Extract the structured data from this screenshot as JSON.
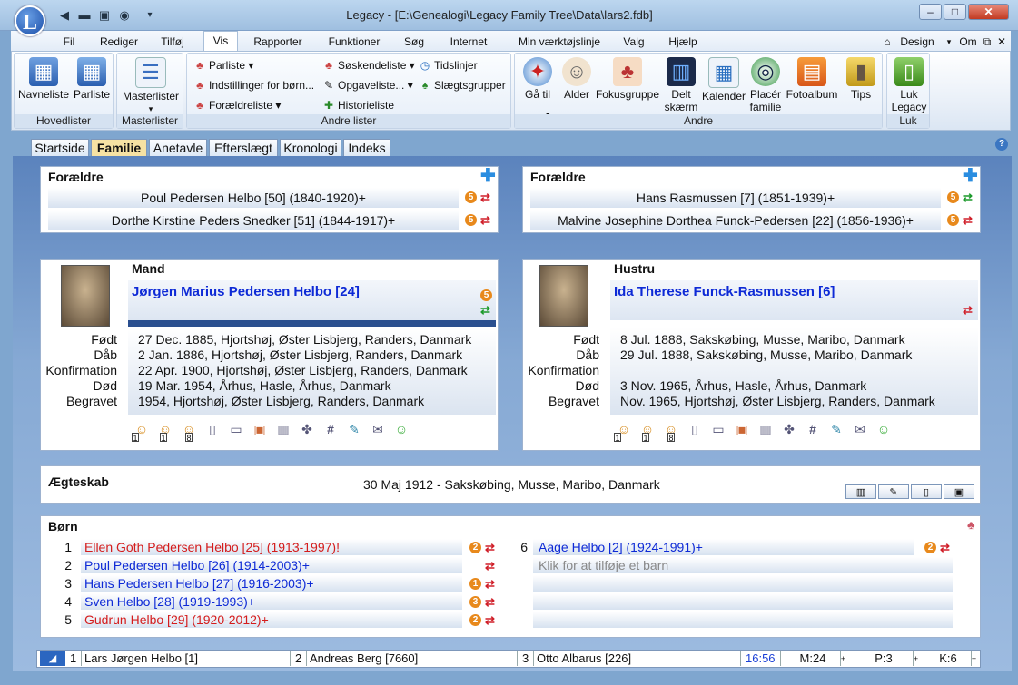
{
  "window": {
    "title": "Legacy - [E:\\Genealogi\\Legacy Family Tree\\Data\\lars2.fdb]",
    "logo": "L"
  },
  "menu": {
    "tabs": [
      "Fil",
      "Rediger",
      "Tilføj",
      "Vis",
      "Rapporter",
      "Funktioner",
      "Søg",
      "Internet",
      "Min værktøjslinje",
      "Valg",
      "Hjælp"
    ],
    "active": "Vis",
    "right": {
      "design": "Design",
      "om": "Om"
    }
  },
  "ribbon": {
    "hovedlister": {
      "label": "Hovedlister",
      "navneliste": "Navneliste",
      "parliste": "Parliste"
    },
    "masterlister": {
      "label": "Masterlister",
      "btn": "Masterlister"
    },
    "andrelister": {
      "label": "Andre lister",
      "parliste": "Parliste",
      "indstillinger": "Indstillinger for børn...",
      "foraeldreliste": "Forældreliste",
      "soskendeliste": "Søskendeliste",
      "opgaveliste": "Opgaveliste...",
      "historieliste": "Historieliste",
      "tidslinjer": "Tidslinjer",
      "slaegtsgrupper": "Slægtsgrupper"
    },
    "andre": {
      "label": "Andre",
      "gaatil": "Gå til",
      "alder": "Alder",
      "fokusgruppe": "Fokusgruppe",
      "deltskaerm1": "Delt",
      "deltskaerm2": "skærm",
      "kalender": "Kalender",
      "placer1": "Placér",
      "placer2": "familie",
      "fotoalbum": "Fotoalbum",
      "tips": "Tips"
    },
    "luk": {
      "label": "Luk",
      "btn1": "Luk",
      "btn2": "Legacy"
    }
  },
  "doctabs": [
    "Startside",
    "Familie",
    "Anetavle",
    "Efterslægt",
    "Kronologi",
    "Indeks"
  ],
  "husband_parents": {
    "title": "Forældre",
    "father": {
      "name": "Poul Pedersen Helbo [50] (1840-1920)+",
      "badge": "5"
    },
    "mother": {
      "name": "Dorthe Kirstine Peders Snedker [51] (1844-1917)+",
      "badge": "5"
    }
  },
  "wife_parents": {
    "title": "Forældre",
    "father": {
      "name": "Hans Rasmussen [7] (1851-1939)+",
      "badge": "5"
    },
    "mother": {
      "name": "Malvine Josephine Dorthea Funck-Pedersen [22] (1856-1936)+",
      "badge": "5"
    }
  },
  "husband": {
    "role": "Mand",
    "name": "Jørgen Marius Pedersen Helbo [24]",
    "badge": "5",
    "facts": [
      {
        "label": "Født",
        "value": "27 Dec. 1885, Hjortshøj, Øster Lisbjerg, Randers, Danmark"
      },
      {
        "label": "Dåb",
        "value": "2 Jan. 1886, Hjortshøj, Øster Lisbjerg, Randers, Danmark"
      },
      {
        "label": "Konfirmation",
        "value": "22 Apr. 1900, Hjortshøj, Øster Lisbjerg, Randers, Danmark"
      },
      {
        "label": "Død",
        "value": "19 Mar. 1954, Århus, Hasle, Århus, Danmark"
      },
      {
        "label": "Begravet",
        "value": "1954, Hjortshøj, Øster Lisbjerg, Randers, Danmark"
      }
    ],
    "counts": [
      "1",
      "1",
      "8"
    ]
  },
  "wife": {
    "role": "Hustru",
    "name": "Ida Therese Funck-Rasmussen [6]",
    "facts": [
      {
        "label": "Født",
        "value": "8 Jul. 1888, Sakskøbing, Musse, Maribo, Danmark"
      },
      {
        "label": "Dåb",
        "value": "29 Jul. 1888, Sakskøbing, Musse, Maribo, Danmark"
      },
      {
        "label": "Konfirmation",
        "value": ""
      },
      {
        "label": "Død",
        "value": "3 Nov. 1965, Århus, Hasle, Århus, Danmark"
      },
      {
        "label": "Begravet",
        "value": "Nov. 1965, Hjortshøj, Øster Lisbjerg, Randers, Danmark"
      }
    ],
    "counts": [
      "1",
      "1",
      "8"
    ]
  },
  "marriage": {
    "title": "Ægteskab",
    "value": "30 Maj 1912 - Sakskøbing, Musse, Maribo, Danmark"
  },
  "children": {
    "title": "Børn",
    "left": [
      {
        "num": "1",
        "name": "Ellen Goth Pedersen Helbo [25] (1913-1997)!",
        "badge": "2"
      },
      {
        "num": "2",
        "name": "Poul Pedersen Helbo [26] (1914-2003)+",
        "badge": ""
      },
      {
        "num": "3",
        "name": "Hans Pedersen Helbo [27] (1916-2003)+",
        "badge": "1"
      },
      {
        "num": "4",
        "name": "Sven Helbo [28] (1919-1993)+",
        "badge": "3"
      },
      {
        "num": "5",
        "name": "Gudrun Helbo [29] (1920-2012)+",
        "badge": "2"
      }
    ],
    "right": [
      {
        "num": "6",
        "name": "Aage Helbo [2] (1924-1991)+",
        "badge": "2"
      },
      {
        "num": "",
        "name": "Klik for at tilføje et barn",
        "badge": ""
      }
    ]
  },
  "statusbar": {
    "p1_num": "1",
    "p1": "Lars Jørgen Helbo [1]",
    "p2_num": "2",
    "p2": "Andreas Berg [7660]",
    "p3_num": "3",
    "p3": "Otto Albarus [226]",
    "time": "16:56",
    "m": "M:24",
    "p": "P:3",
    "k": "K:6"
  },
  "colors": {
    "accent": "#0e2ad6",
    "female": "#d41c1c",
    "badge": "#e8891c"
  }
}
